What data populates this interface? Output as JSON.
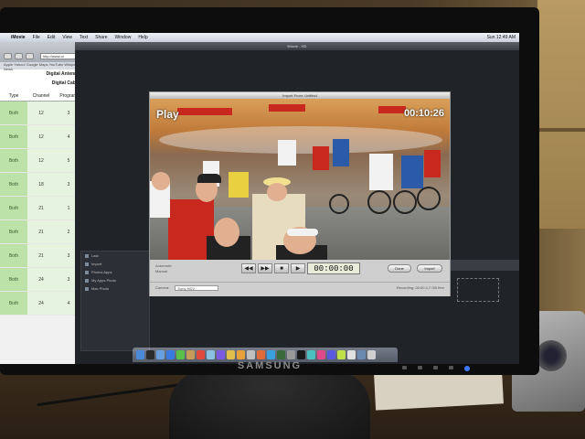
{
  "menubar": {
    "app_name": "iMovie",
    "items": [
      "File",
      "Edit",
      "View",
      "Text",
      "Share",
      "Window",
      "Help"
    ],
    "clock": "Sun 12:49 AM"
  },
  "browser": {
    "url": "http://www.ui",
    "bookmarks": "Apple  Yahoo!  Google Maps  YouTube  Wikipedia  News",
    "page_head_1": "Digital Antenna",
    "page_head_2": "Digital Cable",
    "table": {
      "headers": [
        "Type",
        "Channel",
        "Program"
      ],
      "rows": [
        {
          "type": "Both",
          "channel": "12",
          "program": "3"
        },
        {
          "type": "Both",
          "channel": "12",
          "program": "4"
        },
        {
          "type": "Both",
          "channel": "12",
          "program": "5"
        },
        {
          "type": "Both",
          "channel": "18",
          "program": "3"
        },
        {
          "type": "Both",
          "channel": "21",
          "program": "1"
        },
        {
          "type": "Both",
          "channel": "21",
          "program": "2"
        },
        {
          "type": "Both",
          "channel": "21",
          "program": "3"
        },
        {
          "type": "Both",
          "channel": "24",
          "program": "3"
        },
        {
          "type": "Both",
          "channel": "24",
          "program": "4"
        }
      ]
    }
  },
  "editor": {
    "title": "iMovie - HD",
    "library": [
      "Last",
      "Import",
      "Photos Apps",
      "My Apps Photo",
      "Mac Photo"
    ]
  },
  "player": {
    "title": "Import From: Untitled",
    "overlay_state": "Play",
    "overlay_timecode": "00:10:26",
    "controls": {
      "rewind": "◀◀",
      "forward": "▶▶",
      "stop": "■",
      "play": "▶",
      "timecode": "00:00:00",
      "done": "Done",
      "import": "Import",
      "left_label_1": "Automatic",
      "left_label_2": "Manual",
      "camera_label": "Camera:",
      "camera_value": "Sony HDV",
      "status": "Recording: 00:00  4.7 GB free"
    }
  },
  "monitor": {
    "brand": "SAMSUNG"
  }
}
